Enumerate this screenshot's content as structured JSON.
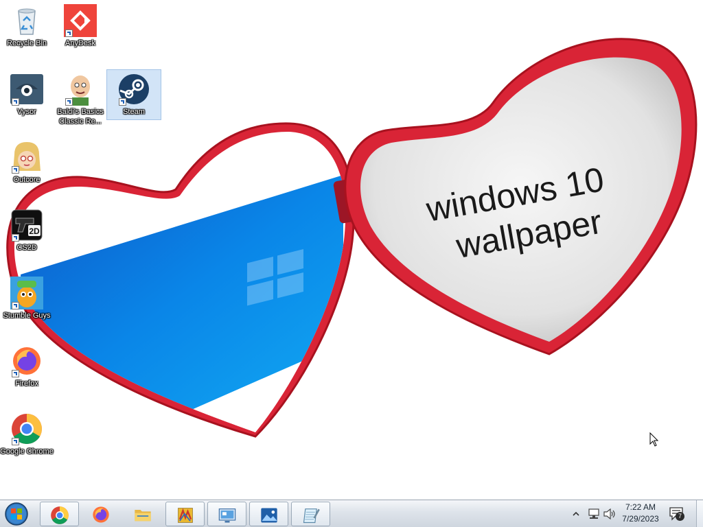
{
  "wallpaper": {
    "line1": "windows 10",
    "line2": "wallpaper"
  },
  "desktop_icons": [
    {
      "label": "Recycle Bin",
      "icon": "recycle-bin-icon"
    },
    {
      "label": "AnyDesk",
      "icon": "anydesk-icon"
    },
    {
      "label": "Vysor",
      "icon": "vysor-icon"
    },
    {
      "label": "Baldi's Basics Classic Re...",
      "icon": "baldi-icon"
    },
    {
      "label": "Steam",
      "icon": "steam-icon",
      "selected": true
    },
    {
      "label": "Outcore",
      "icon": "outcore-icon"
    },
    {
      "label": "CS2D",
      "icon": "cs2d-icon"
    },
    {
      "label": "Stumble Guys",
      "icon": "stumble-guys-icon"
    },
    {
      "label": "Firefox",
      "icon": "firefox-icon"
    },
    {
      "label": "Google Chrome",
      "icon": "chrome-icon"
    }
  ],
  "taskbar": {
    "buttons": [
      "start-icon",
      "chrome-icon",
      "firefox-icon",
      "file-explorer-icon",
      "winrar-icon",
      "remote-desktop-icon",
      "photos-icon",
      "notepad-icon"
    ],
    "tray_icons": [
      "show-hidden-icons-icon",
      "network-icon",
      "volume-icon"
    ],
    "clock": {
      "time": "7:22 AM",
      "date": "7/29/2023"
    },
    "notifications": {
      "count": "7"
    }
  },
  "colors": {
    "heart_red": "#e0283a",
    "win_blue": "#0a78e0",
    "taskbar_bg": "#dde3ea"
  }
}
